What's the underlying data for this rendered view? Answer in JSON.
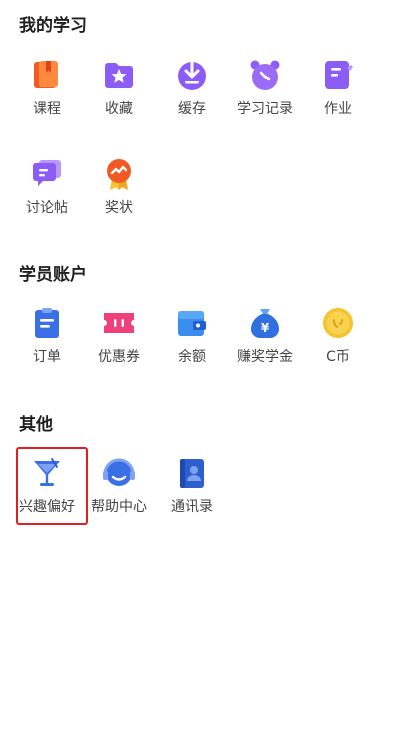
{
  "sections": [
    {
      "title": "我的学习",
      "items": [
        {
          "label": "课程",
          "icon": "course-books-icon"
        },
        {
          "label": "收藏",
          "icon": "favorites-folder-icon"
        },
        {
          "label": "缓存",
          "icon": "download-cache-icon"
        },
        {
          "label": "学习记录",
          "icon": "alarm-clock-icon"
        },
        {
          "label": "作业",
          "icon": "homework-icon"
        },
        {
          "label": "讨论帖",
          "icon": "discussion-icon"
        },
        {
          "label": "奖状",
          "icon": "certificate-medal-icon"
        }
      ]
    },
    {
      "title": "学员账户",
      "items": [
        {
          "label": "订单",
          "icon": "order-clipboard-icon"
        },
        {
          "label": "优惠券",
          "icon": "coupon-icon"
        },
        {
          "label": "余额",
          "icon": "wallet-icon"
        },
        {
          "label": "赚奖学金",
          "icon": "money-bag-icon"
        },
        {
          "label": "C币",
          "icon": "coin-icon"
        }
      ]
    },
    {
      "title": "其他",
      "items": [
        {
          "label": "兴趣偏好",
          "icon": "cocktail-glass-icon"
        },
        {
          "label": "帮助中心",
          "icon": "headset-icon"
        },
        {
          "label": "通讯录",
          "icon": "address-book-icon"
        }
      ]
    }
  ],
  "colors": {
    "purple": "#8b5cf6",
    "blue": "#3b6fe6",
    "orange": "#f25a24",
    "pink": "#f0407c",
    "yellow": "#f7c230",
    "highlight": "#e02020"
  }
}
